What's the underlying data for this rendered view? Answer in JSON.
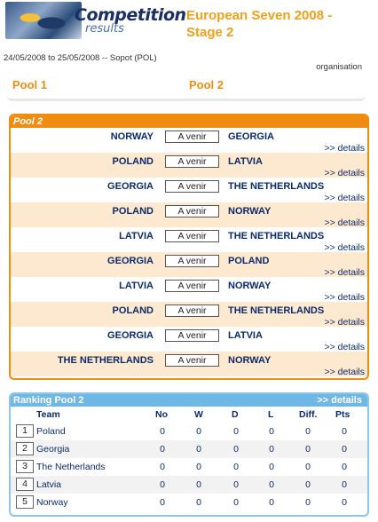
{
  "header": {
    "logo_word1": "Competition",
    "logo_word2": "results",
    "title_line1": "European Seven 2008 -",
    "title_line2": "Stage 2"
  },
  "info": {
    "dateline": "24/05/2008 to 25/05/2008 -- Sopot (POL)",
    "organisation": "organisation"
  },
  "pools": {
    "tab1": "Pool 1",
    "tab2": "Pool 2"
  },
  "pool2": {
    "heading": "Pool 2",
    "score_placeholder": "A venir",
    "details_label": ">> details",
    "matches": [
      {
        "home": "NORWAY",
        "away": "GEORGIA"
      },
      {
        "home": "POLAND",
        "away": "LATVIA"
      },
      {
        "home": "GEORGIA",
        "away": "THE NETHERLANDS"
      },
      {
        "home": "POLAND",
        "away": "NORWAY"
      },
      {
        "home": "LATVIA",
        "away": "THE NETHERLANDS"
      },
      {
        "home": "GEORGIA",
        "away": "POLAND"
      },
      {
        "home": "LATVIA",
        "away": "NORWAY"
      },
      {
        "home": "POLAND",
        "away": "THE NETHERLANDS"
      },
      {
        "home": "GEORGIA",
        "away": "LATVIA"
      },
      {
        "home": "THE NETHERLANDS",
        "away": "NORWAY"
      }
    ]
  },
  "ranking": {
    "heading": "Ranking Pool 2",
    "details_label": ">> details",
    "columns": {
      "team": "Team",
      "no": "No",
      "w": "W",
      "d": "D",
      "l": "L",
      "diff": "Diff.",
      "pts": "Pts"
    },
    "rows": [
      {
        "pos": "1",
        "team": "Poland",
        "no": "0",
        "w": "0",
        "d": "0",
        "l": "0",
        "diff": "0",
        "pts": "0"
      },
      {
        "pos": "2",
        "team": "Georgia",
        "no": "0",
        "w": "0",
        "d": "0",
        "l": "0",
        "diff": "0",
        "pts": "0"
      },
      {
        "pos": "3",
        "team": "The Netherlands",
        "no": "0",
        "w": "0",
        "d": "0",
        "l": "0",
        "diff": "0",
        "pts": "0"
      },
      {
        "pos": "4",
        "team": "Latvia",
        "no": "0",
        "w": "0",
        "d": "0",
        "l": "0",
        "diff": "0",
        "pts": "0"
      },
      {
        "pos": "5",
        "team": "Norway",
        "no": "0",
        "w": "0",
        "d": "0",
        "l": "0",
        "diff": "0",
        "pts": "0"
      }
    ]
  },
  "colors": {
    "accent_orange": "#f08c10",
    "title_orange": "#f0a018",
    "ranking_blue": "#6fb8e6",
    "text_navy": "#0b2a6b",
    "alt_row": "#fde9cf"
  }
}
